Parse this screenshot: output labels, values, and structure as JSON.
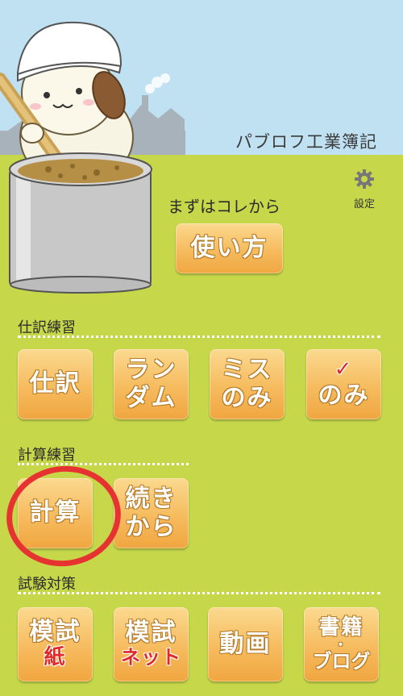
{
  "header": {
    "app_title": "パブロフ工業簿記",
    "settings_label": "設定"
  },
  "intro": {
    "label": "まずはコレから",
    "how_to_button": "使い方"
  },
  "sections": {
    "journal": {
      "title": "仕訳練習",
      "buttons": {
        "journal": [
          "仕訳"
        ],
        "random": [
          "ラン",
          "ダム"
        ],
        "mistakes": [
          "ミス",
          "のみ"
        ],
        "checked_mark": "✓",
        "checked": "のみ"
      }
    },
    "calc": {
      "title": "計算練習",
      "buttons": {
        "calc": "計算",
        "continue": [
          "続き",
          "から"
        ]
      }
    },
    "exam": {
      "title": "試験対策",
      "buttons": {
        "mock_paper": [
          "模試",
          "紙"
        ],
        "mock_net": [
          "模試",
          "ネット"
        ],
        "video": "動画",
        "books": [
          "書籍",
          "・",
          "ブログ"
        ]
      }
    }
  },
  "colors": {
    "background": "#c6d84a",
    "sky": "#bfe1f2",
    "button": "#f6bb5e",
    "annotation_circle": "#e73232"
  }
}
